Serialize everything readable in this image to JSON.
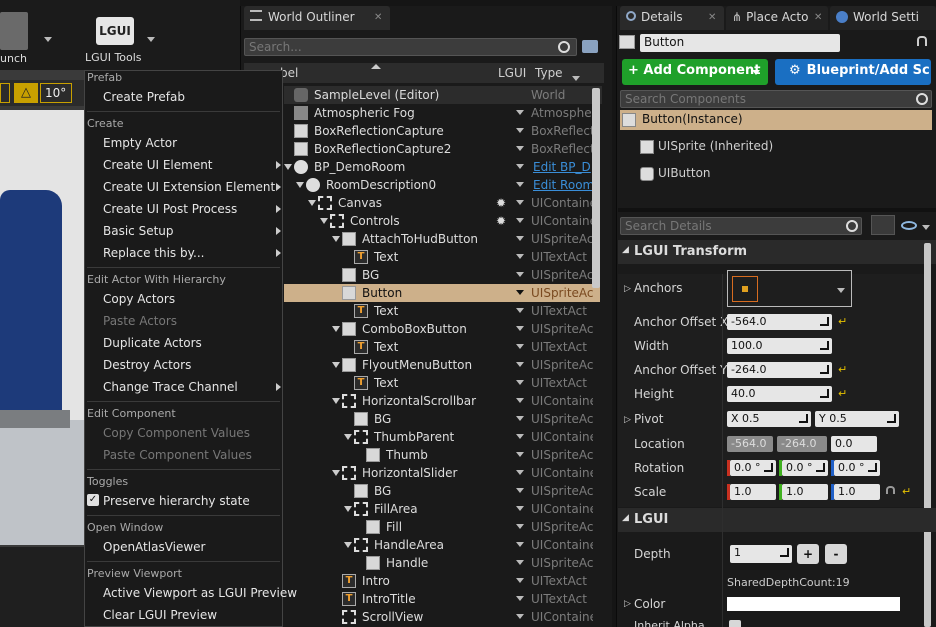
{
  "toolbar": {
    "launch_label": "unch",
    "lgui_tools_label": "LGUI Tools",
    "lgui_logo_text": "LGUI",
    "snap_value": "10°"
  },
  "outliner": {
    "tab_label": "World Outliner",
    "search_placeholder": "Search...",
    "col_label": "bel",
    "col_lgui": "LGUI",
    "col_type": "Type",
    "rows": [
      {
        "label": "SampleLevel (Editor)",
        "type": "World"
      },
      {
        "label": "Atmospheric Fog",
        "type": "Atmosphe"
      },
      {
        "label": "BoxReflectionCapture",
        "type": "BoxReflect"
      },
      {
        "label": "BoxReflectionCapture2",
        "type": "BoxReflect"
      },
      {
        "label": "BP_DemoRoom",
        "type": "Edit BP_D"
      },
      {
        "label": "RoomDescription0",
        "type": "Edit Room"
      },
      {
        "label": "Canvas",
        "type": "UIContaine"
      },
      {
        "label": "Controls",
        "type": "UIContaine"
      },
      {
        "label": "AttachToHudButton",
        "type": "UISpriteAc"
      },
      {
        "label": "Text",
        "type": "UITextAct"
      },
      {
        "label": "BG",
        "type": "UISpriteAc"
      },
      {
        "label": "Button",
        "type": "UISpriteAc"
      },
      {
        "label": "Text",
        "type": "UITextAct"
      },
      {
        "label": "ComboBoxButton",
        "type": "UISpriteAc"
      },
      {
        "label": "Text",
        "type": "UITextAct"
      },
      {
        "label": "FlyoutMenuButton",
        "type": "UISpriteAc"
      },
      {
        "label": "Text",
        "type": "UITextAct"
      },
      {
        "label": "HorizontalScrollbar",
        "type": "UIContaine"
      },
      {
        "label": "BG",
        "type": "UISpriteAc"
      },
      {
        "label": "ThumbParent",
        "type": "UIContaine"
      },
      {
        "label": "Thumb",
        "type": "UISpriteAc"
      },
      {
        "label": "HorizontalSlider",
        "type": "UIContaine"
      },
      {
        "label": "BG",
        "type": "UISpriteAc"
      },
      {
        "label": "FillArea",
        "type": "UIContaine"
      },
      {
        "label": "Fill",
        "type": "UISpriteAc"
      },
      {
        "label": "HandleArea",
        "type": "UIContaine"
      },
      {
        "label": "Handle",
        "type": "UISpriteAc"
      },
      {
        "label": "Intro",
        "type": "UITextAct"
      },
      {
        "label": "IntroTitle",
        "type": "UITextAct"
      },
      {
        "label": "ScrollView",
        "type": "UIContaine"
      }
    ]
  },
  "menu": {
    "h_prefab": "Prefab",
    "create_prefab": "Create Prefab",
    "h_create": "Create",
    "empty_actor": "Empty Actor",
    "create_ui_element": "Create UI Element",
    "create_ui_ext": "Create UI Extension Element",
    "create_ui_post": "Create UI Post Process",
    "basic_setup": "Basic Setup",
    "replace_this": "Replace this by...",
    "h_edit_actor": "Edit Actor With Hierarchy",
    "copy_actors": "Copy Actors",
    "paste_actors": "Paste Actors",
    "duplicate_actors": "Duplicate Actors",
    "destroy_actors": "Destroy Actors",
    "change_trace": "Change Trace Channel",
    "h_edit_comp": "Edit Component",
    "copy_comp": "Copy Component Values",
    "paste_comp": "Paste Component Values",
    "h_toggles": "Toggles",
    "preserve": "Preserve hierarchy state",
    "h_open_window": "Open Window",
    "open_atlas": "OpenAtlasViewer",
    "h_preview": "Preview Viewport",
    "active_vp": "Active Viewport as LGUI Preview",
    "clear_preview": "Clear LGUI Preview"
  },
  "details": {
    "tab_details": "Details",
    "tab_place": "Place Acto",
    "tab_world": "World Setti",
    "actor_name": "Button",
    "add_component": "+ Add Component",
    "blueprint": "Blueprint/Add Sc",
    "search_components": "Search Components",
    "comp_instance": "Button(Instance)",
    "comp_sprite": "UISprite (Inherited)",
    "comp_button": "UIButton",
    "search_details": "Search Details",
    "sect_transform": "LGUI Transform",
    "anchors": "Anchors",
    "anchor_offset_x": "Anchor Offset X",
    "anchor_offset_x_val": "-564.0",
    "width": "Width",
    "width_val": "100.0",
    "anchor_offset_y": "Anchor Offset Y",
    "anchor_offset_y_val": "-264.0",
    "height": "Height",
    "height_val": "40.0",
    "pivot": "Pivot",
    "pivot_x": "X  0.5",
    "pivot_y": "Y  0.5",
    "location": "Location",
    "loc_x": "-564.0",
    "loc_y": "-264.0",
    "loc_z": "0.0",
    "rotation": "Rotation",
    "rot_x": "0.0 °",
    "rot_y": "0.0 °",
    "rot_z": "0.0 °",
    "scale": "Scale",
    "scale_x": "1.0",
    "scale_y": "1.0",
    "scale_z": "1.0",
    "sect_lgui": "LGUI",
    "depth": "Depth",
    "depth_val": "1",
    "shared_depth": "SharedDepthCount:19",
    "color": "Color",
    "inherit_alpha": "Inherit Alpha"
  },
  "colors": {
    "add_component": "#1fa02a",
    "blueprint": "#1a6fc2",
    "selected_row": "#cdb08a",
    "link": "#3a8ed8"
  }
}
